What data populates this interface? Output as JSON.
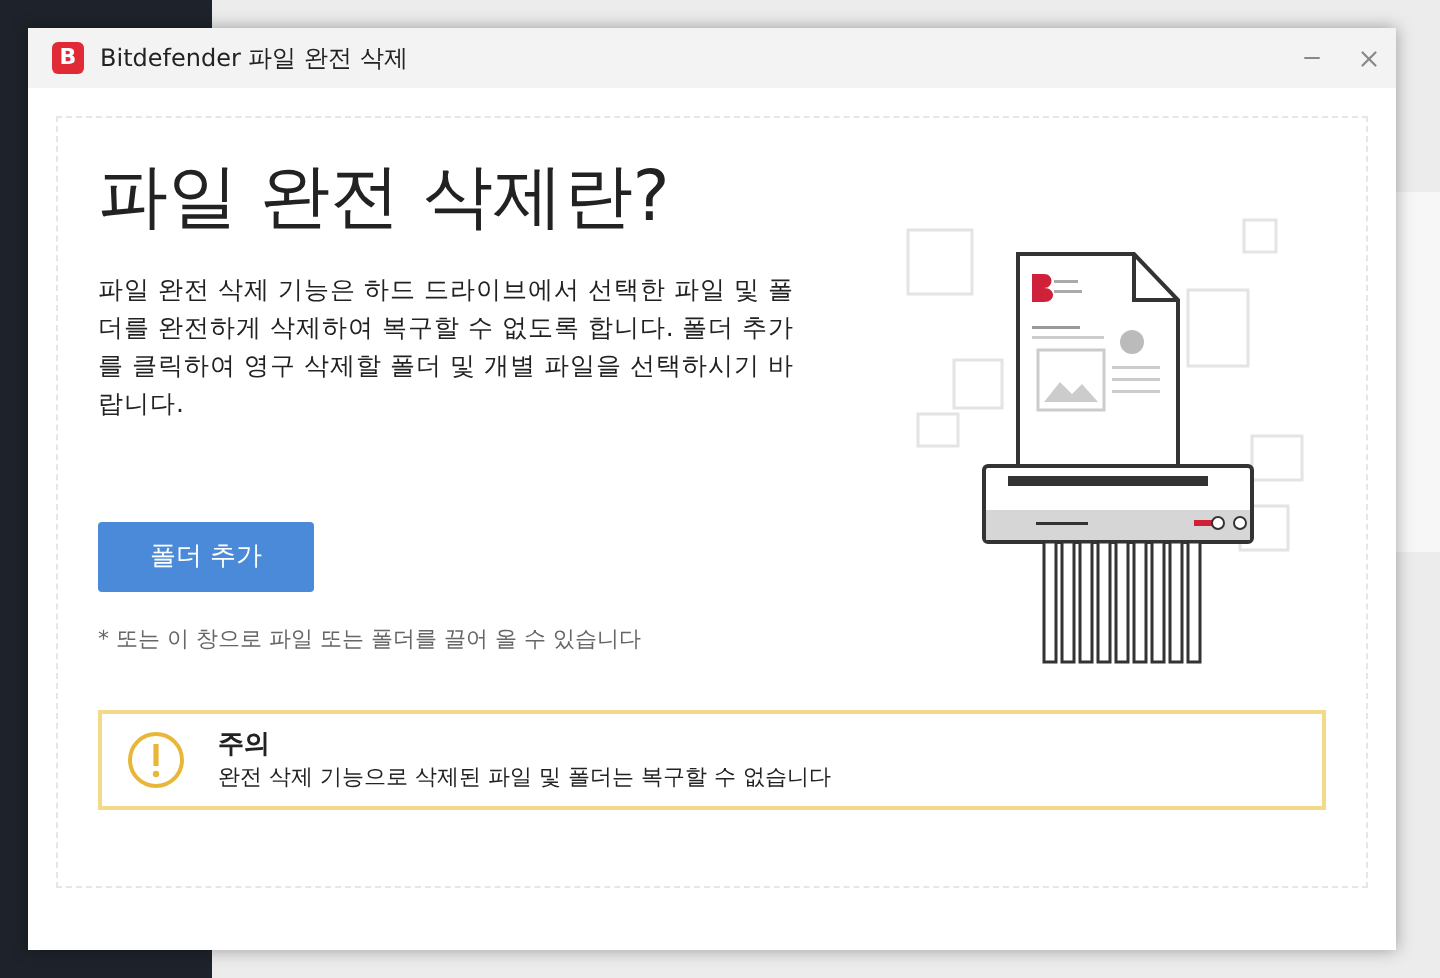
{
  "window": {
    "title": "Bitdefender 파일 완전 삭제",
    "logo": "B"
  },
  "content": {
    "heading": "파일 완전 삭제란?",
    "description": "파일 완전 삭제 기능은 하드 드라이브에서 선택한 파일 및 폴더를 완전하게 삭제하여 복구할 수 없도록 합니다. 폴더 추가를 클릭하여 영구 삭제할 폴더 및 개별 파일을 선택하시기 바랍니다.",
    "button": "폴더 추가",
    "hint": "* 또는 이 창으로 파일 또는 폴더를 끌어 올 수 있습니다"
  },
  "warning": {
    "title": "주의",
    "message": "완전 삭제 기능으로 삭제된 파일 및 폴더는 복구할 수 없습니다"
  }
}
